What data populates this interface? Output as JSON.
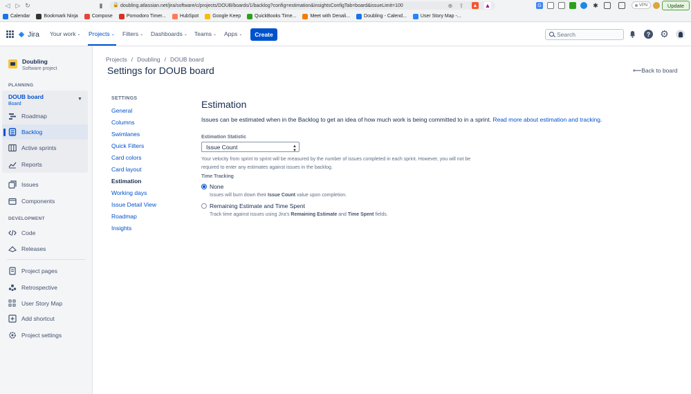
{
  "browser": {
    "url": "doubling.atlassian.net/jira/software/c/projects/DOUB/boards/1/backlog?config=estimation&insightsConfigTab=board&issueLimit=100",
    "vpn_label": "VPN",
    "update_label": "Update",
    "bookmarks": [
      {
        "label": "Calendar",
        "color": "#1a73e8"
      },
      {
        "label": "Bookmark Ninja",
        "color": "#333333"
      },
      {
        "label": "Compose",
        "color": "#ea4335"
      },
      {
        "label": "Pomodoro Timer...",
        "color": "#d93025"
      },
      {
        "label": "HubSpot",
        "color": "#ff7a59"
      },
      {
        "label": "Google Keep",
        "color": "#fbbc04"
      },
      {
        "label": "QuickBooks Time...",
        "color": "#2ca01c"
      },
      {
        "label": "Meet with Denali...",
        "color": "#f57c00"
      },
      {
        "label": "Doubling - Calend...",
        "color": "#1a73e8"
      },
      {
        "label": "User Story Map -...",
        "color": "#2684ff"
      }
    ]
  },
  "jira_nav": {
    "product": "Jira",
    "menus": [
      "Your work",
      "Projects",
      "Filters",
      "Dashboards",
      "Teams",
      "Apps"
    ],
    "create_label": "Create",
    "search_placeholder": "Search"
  },
  "sidebar": {
    "project_name": "Doubling",
    "project_type": "Software project",
    "planning_heading": "PLANNING",
    "board_name": "DOUB board",
    "board_sub": "Board",
    "planning_items": [
      "Roadmap",
      "Backlog",
      "Active sprints",
      "Reports"
    ],
    "other_items": [
      "Issues",
      "Components"
    ],
    "development_heading": "DEVELOPMENT",
    "development_items": [
      "Code",
      "Releases"
    ],
    "bottom_items": [
      "Project pages",
      "Retrospective",
      "User Story Map",
      "Add shortcut",
      "Project settings"
    ]
  },
  "header": {
    "breadcrumbs": [
      "Projects",
      "Doubling",
      "DOUB board"
    ],
    "title": "Settings for DOUB board",
    "back_label": "Back to board"
  },
  "settings_nav": {
    "heading": "SETTINGS",
    "links": [
      "General",
      "Columns",
      "Swimlanes",
      "Quick Filters",
      "Card colors",
      "Card layout",
      "Estimation",
      "Working days",
      "Issue Detail View",
      "Roadmap",
      "Insights"
    ],
    "current": "Estimation"
  },
  "estimation": {
    "title": "Estimation",
    "description": "Issues can be estimated when in the Backlog to get an idea of how much work is being committed to in a sprint.",
    "read_more_link": "Read more about estimation and tracking",
    "statistic_label": "Estimation Statistic",
    "statistic_value": "Issue Count",
    "velocity_help_line1": "Your velocity from sprint to sprint will be measured by the number of issues completed in each sprint. However, you will not be",
    "velocity_help_line2": "required to enter any estimates against issues in the backlog.",
    "time_tracking_label": "Time Tracking",
    "options": [
      {
        "label": "None",
        "selected": true,
        "help_pre": "Issues will burn down their ",
        "help_bold1": "Issue Count",
        "help_mid": " value upon completion.",
        "help_bold2": "",
        "help_post": ""
      },
      {
        "label": "Remaining Estimate and Time Spent",
        "selected": false,
        "help_pre": "Track time against issues using Jira's ",
        "help_bold1": "Remaining Estimate",
        "help_mid": " and ",
        "help_bold2": "Time Spent",
        "help_post": " fields."
      }
    ]
  },
  "colors": {
    "accent": "#0052cc",
    "sidebar_bg": "#f4f5f7",
    "text": "#172b4d"
  }
}
